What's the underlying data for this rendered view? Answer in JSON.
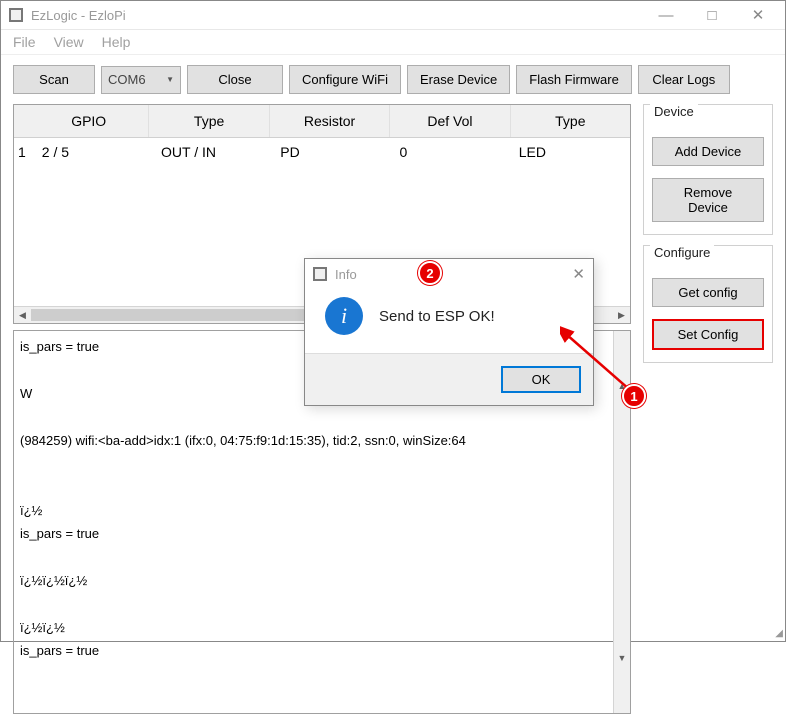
{
  "window": {
    "title": "EzLogic - EzloPi"
  },
  "menu": {
    "file": "File",
    "view": "View",
    "help": "Help"
  },
  "toolbar": {
    "scan": "Scan",
    "com_port": "COM6",
    "close": "Close",
    "configure_wifi": "Configure WiFi",
    "erase_device": "Erase Device",
    "flash_firmware": "Flash Firmware",
    "clear_logs": "Clear Logs"
  },
  "table": {
    "headers": {
      "index": "",
      "gpio": "GPIO",
      "type": "Type",
      "resistor": "Resistor",
      "def_vol": "Def Vol",
      "devtype": "Type"
    },
    "row1": {
      "index": "1",
      "gpio": "2 / 5",
      "type": "OUT / IN",
      "resistor": "PD",
      "def_vol": "0",
      "devtype": "LED"
    }
  },
  "log": "is_pars = true\n\nW\n\n(984259) wifi:<ba-add>idx:1 (ifx:0, 04:75:f9:1d:15:35), tid:2, ssn:0, winSize:64\n\n\nï¿½\nis_pars = true\n\nï¿½ï¿½ï¿½\n\nï¿½ï¿½\nis_pars = true",
  "panels": {
    "device": {
      "title": "Device",
      "add": "Add Device",
      "remove": "Remove Device"
    },
    "configure": {
      "title": "Configure",
      "get": "Get config",
      "set": "Set Config"
    }
  },
  "dialog": {
    "title": "Info",
    "message": "Send to ESP OK!",
    "ok": "OK"
  },
  "annotations": {
    "step1": "1",
    "step2": "2"
  }
}
